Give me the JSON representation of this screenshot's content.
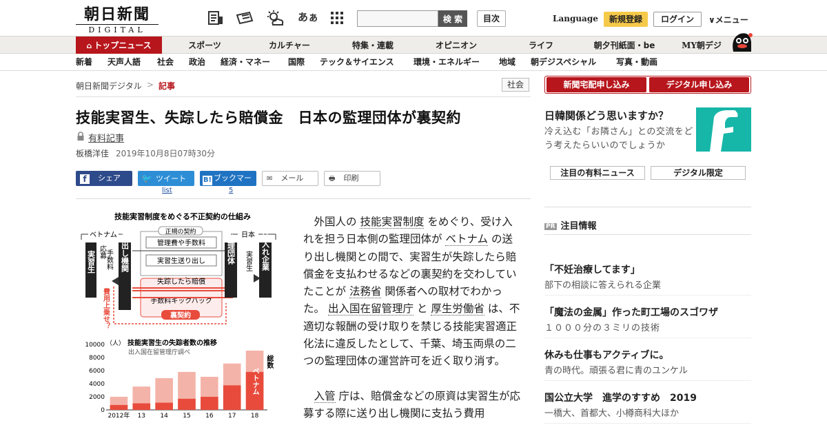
{
  "header": {
    "logo_top": "朝日新聞",
    "logo_bottom": "DIGITAL",
    "search_placeholder": "",
    "search_label": "検 索",
    "mokuji_label": "目次",
    "aa_label": "あぁ",
    "language_label": "Language",
    "register_label": "新規登録",
    "login_label": "ログイン",
    "menu_label": "∨メニュー"
  },
  "nav_main": [
    {
      "label": "トップニュース",
      "active": true
    },
    {
      "label": "スポーツ"
    },
    {
      "label": "カルチャー"
    },
    {
      "label": "特集・連載"
    },
    {
      "label": "オピニオン"
    },
    {
      "label": "ライフ"
    },
    {
      "label": "朝夕刊紙面・be"
    },
    {
      "label": "MY朝デジ"
    }
  ],
  "nav_sub": [
    "新着",
    "天声人語",
    "社会",
    "政治",
    "経済・マネー",
    "国際",
    "テック＆サイエンス",
    "環境・エネルギー",
    "地域",
    "朝デジスペシャル",
    "写真・動画"
  ],
  "breadcrumb": {
    "home": "朝日新聞デジタル",
    "sep": ">",
    "current": "記事",
    "category": "社会"
  },
  "article": {
    "title": "技能実習生、失踪したら賠償金　日本の監理団体が裏契約",
    "paid_label": "有料記事",
    "author": "板橋洋佳",
    "date": "2019年10月8日07時30分",
    "share": {
      "facebook": "シェア",
      "twitter": "ツイート",
      "twitter_count": "list",
      "hatena": "ブックマーク",
      "hatena_count": "5",
      "mail": "メール",
      "print": "印刷"
    },
    "para1": {
      "s1": "外国人の",
      "l1": "技能実習制度",
      "s2": "をめぐり、受け入れを担う日本側の監理団体が",
      "l2": "ベトナム",
      "s3": "の送り出し機関との間で、実習生が失踪したら賠償金を支払わせるなどの裏契約を交わしていたことが",
      "l3": "法務省",
      "s4": "関係者への取材でわかった。",
      "l4": "出入国在留管理庁",
      "s5": "と",
      "l5": "厚生労働省",
      "s6": "は、不適切な報酬の受け取りを禁じる技能実習適正化法に違反したとして、千葉、埼玉両県の二つの監理団体の運営許可を近く取り消す。"
    },
    "para2": {
      "l1": "入管",
      "s1": "庁は、賠償金などの原資は実習生が応募する際に送り出し機関に支払う費用"
    }
  },
  "diagram": {
    "title": "技能実習制度をめぐる不正契約の仕組み",
    "left_country": "ベトナム",
    "right_country": "日本",
    "trainee_left": "実習生",
    "fee_label": "手数料",
    "fee_label_top": "応募",
    "sending_org": "送り出し機関",
    "regular_contract": "正規の契約",
    "reg_item1": "管理費や手数料",
    "reg_item2": "実習生送り出し",
    "secret_item1": "失踪したら賠償",
    "secret_item2": "手数料キックバック",
    "secret_label": "裏契約",
    "cost_label": "費用上乗せ？",
    "supervising_org": "監理団体",
    "trainee_right": "実習生",
    "employer": "受け入れ企業"
  },
  "chart_data": {
    "type": "bar",
    "title": "技能実習生の失踪者数の推移",
    "subtitle": "出入国在留管理庁調べ",
    "ylabel": "（人）",
    "categories": [
      "2012年",
      "13",
      "14",
      "15",
      "16",
      "17",
      "18"
    ],
    "ylim": [
      0,
      10000
    ],
    "yticks": [
      "10000",
      "8000",
      "6000",
      "4000",
      "2000",
      "0"
    ],
    "series": [
      {
        "name": "総数",
        "values": [
          2005,
          3566,
          4847,
          5803,
          5058,
          7089,
          9052
        ],
        "color": "#f4b3a8"
      },
      {
        "name": "ベトナム",
        "values": [
          750,
          1000,
          1100,
          1700,
          2000,
          3750,
          5800
        ],
        "color": "#e84b3c"
      }
    ]
  },
  "right": {
    "delivery_btn": "新聞宅配申し込み",
    "digital_btn": "デジタル申し込み",
    "ad_title": "日韓関係どう思いますか？",
    "ad_text": "冷え込む「お隣さん」との交流をどう考えたらいいのでしょうか",
    "paid_news_btn": "注目の有料ニュース",
    "digital_only_btn": "デジタル限定",
    "pr_badge": "PR",
    "pr_heading": "注目情報",
    "pr_items": [
      {
        "title": "「不妊治療してます」",
        "sub": "部下の相談に答えられる企業"
      },
      {
        "title": "「魔法の金属」作った町工場のスゴワザ",
        "sub": "１０００分の３ミリの技術"
      },
      {
        "title": "休みも仕事もアクティブに。",
        "sub": "青の時代。頑張る君に青のユンケル"
      },
      {
        "title": "国公立大学　進学のすすめ　2019",
        "sub": "一橋大、首都大、小樽商科大ほか"
      }
    ]
  },
  "colors": {
    "brand_red": "#b7161c",
    "accent_yellow": "#f5c94a",
    "teal": "#16b6a8",
    "facebook": "#2d4a8a",
    "twitter": "#2d8ed6",
    "hatena": "#1f73c2"
  }
}
